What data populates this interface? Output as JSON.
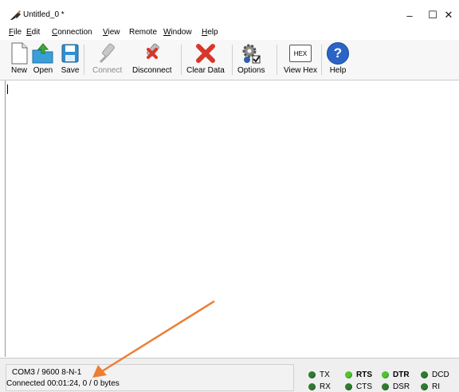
{
  "window": {
    "title": "Untitled_0 *",
    "controls": {
      "minimize": "–",
      "maximize": "☐",
      "close": "✕"
    }
  },
  "menu": {
    "items": [
      {
        "label": "File",
        "key": "F",
        "rest": "ile"
      },
      {
        "label": "Edit",
        "key": "E",
        "rest": "dit"
      },
      {
        "label": "Connection",
        "key": "C",
        "rest": "onnection"
      },
      {
        "label": "View",
        "key": "V",
        "rest": "iew"
      },
      {
        "label": "Remote",
        "key": "",
        "rest": "Remote"
      },
      {
        "label": "Window",
        "key": "W",
        "rest": "indow"
      },
      {
        "label": "Help",
        "key": "H",
        "rest": "elp"
      }
    ]
  },
  "toolbar": {
    "buttons": [
      {
        "label": "New",
        "icon": "new-document-icon",
        "enabled": true
      },
      {
        "label": "Open",
        "icon": "open-folder-icon",
        "enabled": true
      },
      {
        "label": "Save",
        "icon": "save-floppy-icon",
        "enabled": true
      },
      {
        "label": "Connect",
        "icon": "usb-plug-icon",
        "enabled": false
      },
      {
        "label": "Disconnect",
        "icon": "usb-disconnect-icon",
        "enabled": true
      },
      {
        "label": "Clear Data",
        "icon": "red-x-icon",
        "enabled": true
      },
      {
        "label": "Options",
        "icon": "gears-checkbox-icon",
        "enabled": true
      },
      {
        "label": "View Hex",
        "icon": "hex-icon",
        "enabled": true,
        "icon_text": "HEX"
      },
      {
        "label": "Help",
        "icon": "help-question-icon",
        "enabled": true,
        "icon_text": "?"
      }
    ]
  },
  "status": {
    "port_settings": "COM3 / 9600 8-N-1",
    "connection": "Connected 00:01:24, 0 / 0 bytes"
  },
  "signals": {
    "tx": {
      "label": "TX",
      "state": "dark"
    },
    "rx": {
      "label": "RX",
      "state": "dark"
    },
    "rts": {
      "label": "RTS",
      "state": "bright"
    },
    "cts": {
      "label": "CTS",
      "state": "dark"
    },
    "dtr": {
      "label": "DTR",
      "state": "bright"
    },
    "dsr": {
      "label": "DSR",
      "state": "dark"
    },
    "dcd": {
      "label": "DCD",
      "state": "dark"
    },
    "ri": {
      "label": "RI",
      "state": "dark"
    }
  },
  "annotation": {
    "color": "#ee7e33",
    "icon": "orange-arrow-annotation"
  },
  "colors": {
    "led_on": "#4fc42f",
    "led_off": "#2d7d2d",
    "toolbar_bg": "#f7f7f7",
    "status_bg": "#efefef"
  }
}
